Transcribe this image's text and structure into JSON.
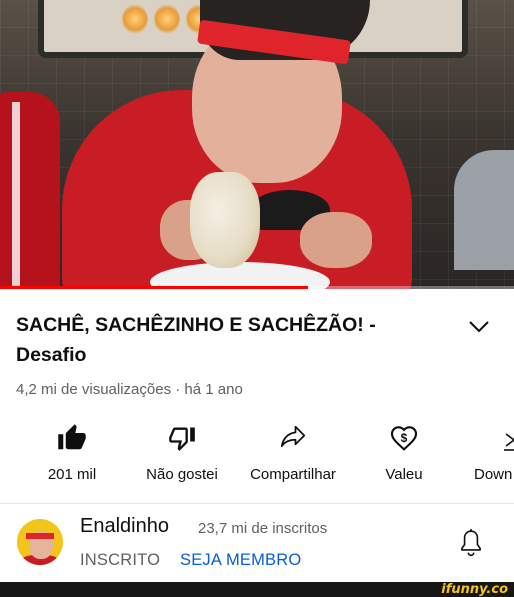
{
  "video": {
    "progress_percent": 60
  },
  "title": "SACHÊ, SACHÊZINHO E SACHÊZÃO! - Desafio",
  "meta": "4,2 mi de visualizações · há 1 ano",
  "actions": {
    "like": {
      "icon": "thumbs-up-filled-icon",
      "label": "201 mil"
    },
    "dislike": {
      "icon": "thumbs-down-icon",
      "label": "Não gostei"
    },
    "share": {
      "icon": "share-arrow-icon",
      "label": "Compartilhar"
    },
    "valeu": {
      "icon": "heart-dollar-icon",
      "label": "Valeu"
    },
    "download": {
      "icon": "download-icon",
      "label": "Down"
    }
  },
  "channel": {
    "name": "Enaldinho",
    "subscribers": "23,7 mi de inscritos",
    "subscribed_label": "INSCRITO",
    "member_label": "SEJA MEMBRO",
    "bell_icon": "bell-icon"
  },
  "colors": {
    "member_link": "#065fd4",
    "progress": "#ff0000",
    "secondary_text": "#606060"
  },
  "watermark": "ifunny.co"
}
